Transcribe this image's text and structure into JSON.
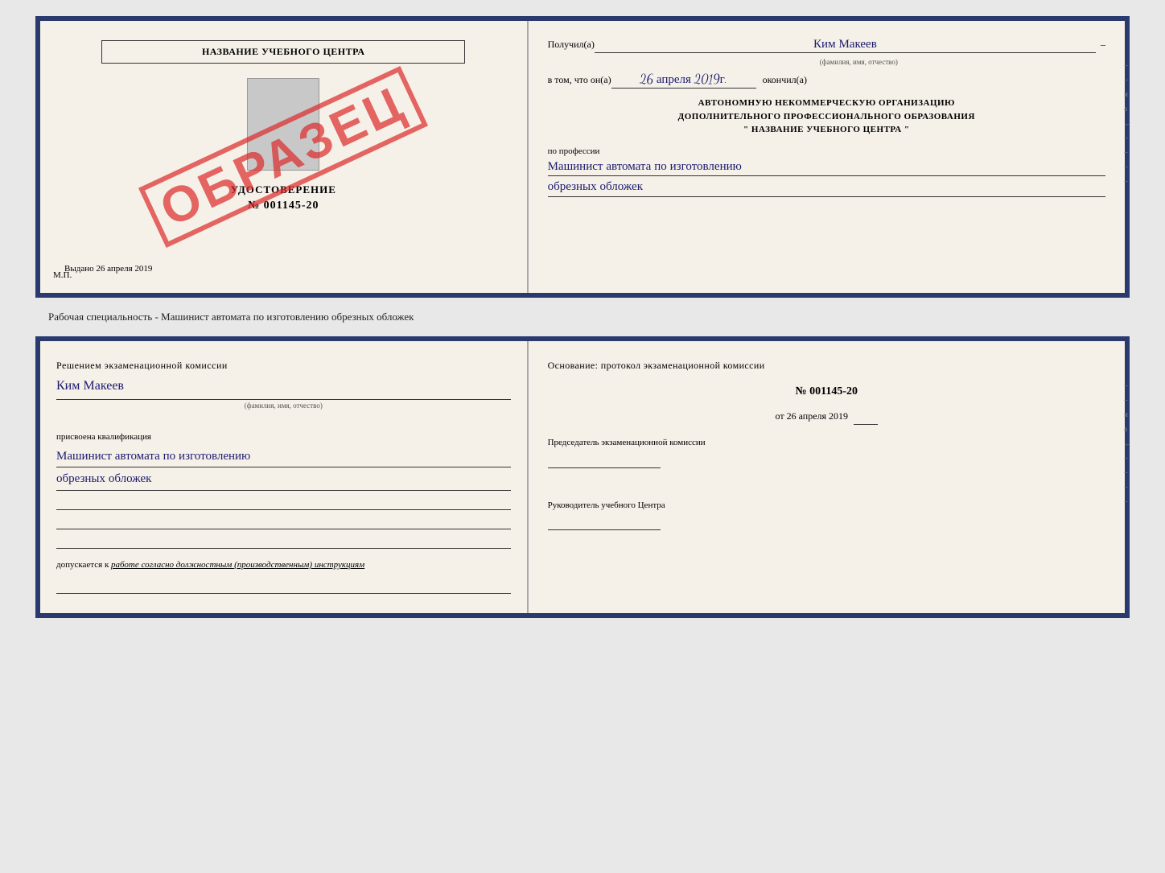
{
  "top_document": {
    "left": {
      "school_name": "НАЗВАНИЕ УЧЕБНОГО ЦЕНТРА",
      "cert_label": "УДОСТОВЕРЕНИЕ",
      "cert_number": "№ 001145-20",
      "issued_label": "Выдано",
      "issued_date": "26 апреля 2019",
      "mp_label": "М.П.",
      "stamp_text": "ОБРАЗЕЦ"
    },
    "right": {
      "received_label": "Получил(а)",
      "received_name": "Ким Макеев",
      "name_sublabel": "(фамилия, имя, отчество)",
      "in_that_label": "в том, что он(а)",
      "completed_date": "26 апреля 2019г.",
      "completed_label": "окончил(а)",
      "org_line1": "АВТОНОМНУЮ НЕКОММЕРЧЕСКУЮ ОРГАНИЗАЦИЮ",
      "org_line2": "ДОПОЛНИТЕЛЬНОГО ПРОФЕССИОНАЛЬНОГО ОБРАЗОВАНИЯ",
      "org_line3": "\"  НАЗВАНИЕ УЧЕБНОГО ЦЕНТРА  \"",
      "profession_label": "по профессии",
      "profession_line1": "Машинист автомата по изготовлению",
      "profession_line2": "обрезных обложек"
    }
  },
  "between_label": "Рабочая специальность - Машинист автомата по изготовлению обрезных обложек",
  "bottom_document": {
    "left": {
      "decision_label": "Решением экзаменационной комиссии",
      "person_name": "Ким Макеев",
      "name_sublabel": "(фамилия, имя, отчество)",
      "qualification_label": "присвоена квалификация",
      "qualification_line1": "Машинист автомата по изготовлению",
      "qualification_line2": "обрезных обложек",
      "допускается_label": "допускается к",
      "допускается_value": "работе согласно должностным (производственным) инструкциям"
    },
    "right": {
      "basis_label": "Основание: протокол экзаменационной комиссии",
      "protocol_number": "№ 001145-20",
      "protocol_date_prefix": "от",
      "protocol_date": "26 апреля 2019",
      "chairman_label": "Председатель экзаменационной комиссии",
      "director_label": "Руководитель учебного Центра"
    }
  }
}
